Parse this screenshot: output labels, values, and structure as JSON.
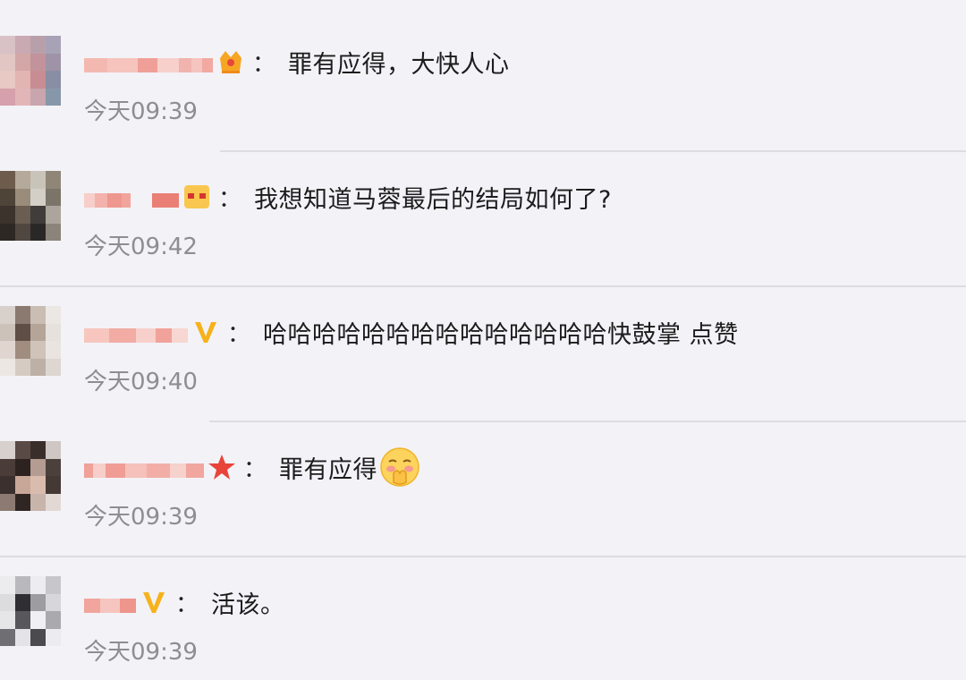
{
  "comments": [
    {
      "text": "罪有应得，大快人心",
      "time": "今天09:39",
      "badge": "crown-badge"
    },
    {
      "text": "我想知道马蓉最后的结局如何了?",
      "time": "今天09:42",
      "badge": "gold-face-badge"
    },
    {
      "text": "哈哈哈哈哈哈哈哈哈哈哈哈哈哈快鼓掌 点赞",
      "time": "今天09:40",
      "badge": "v-badge"
    },
    {
      "text": "罪有应得",
      "time": "今天09:39",
      "badge": "red-star-badge",
      "emoji": "shy-face-emoji"
    },
    {
      "text": "活该。",
      "time": "今天09:39",
      "badge": "v-badge"
    }
  ],
  "separator": "："
}
